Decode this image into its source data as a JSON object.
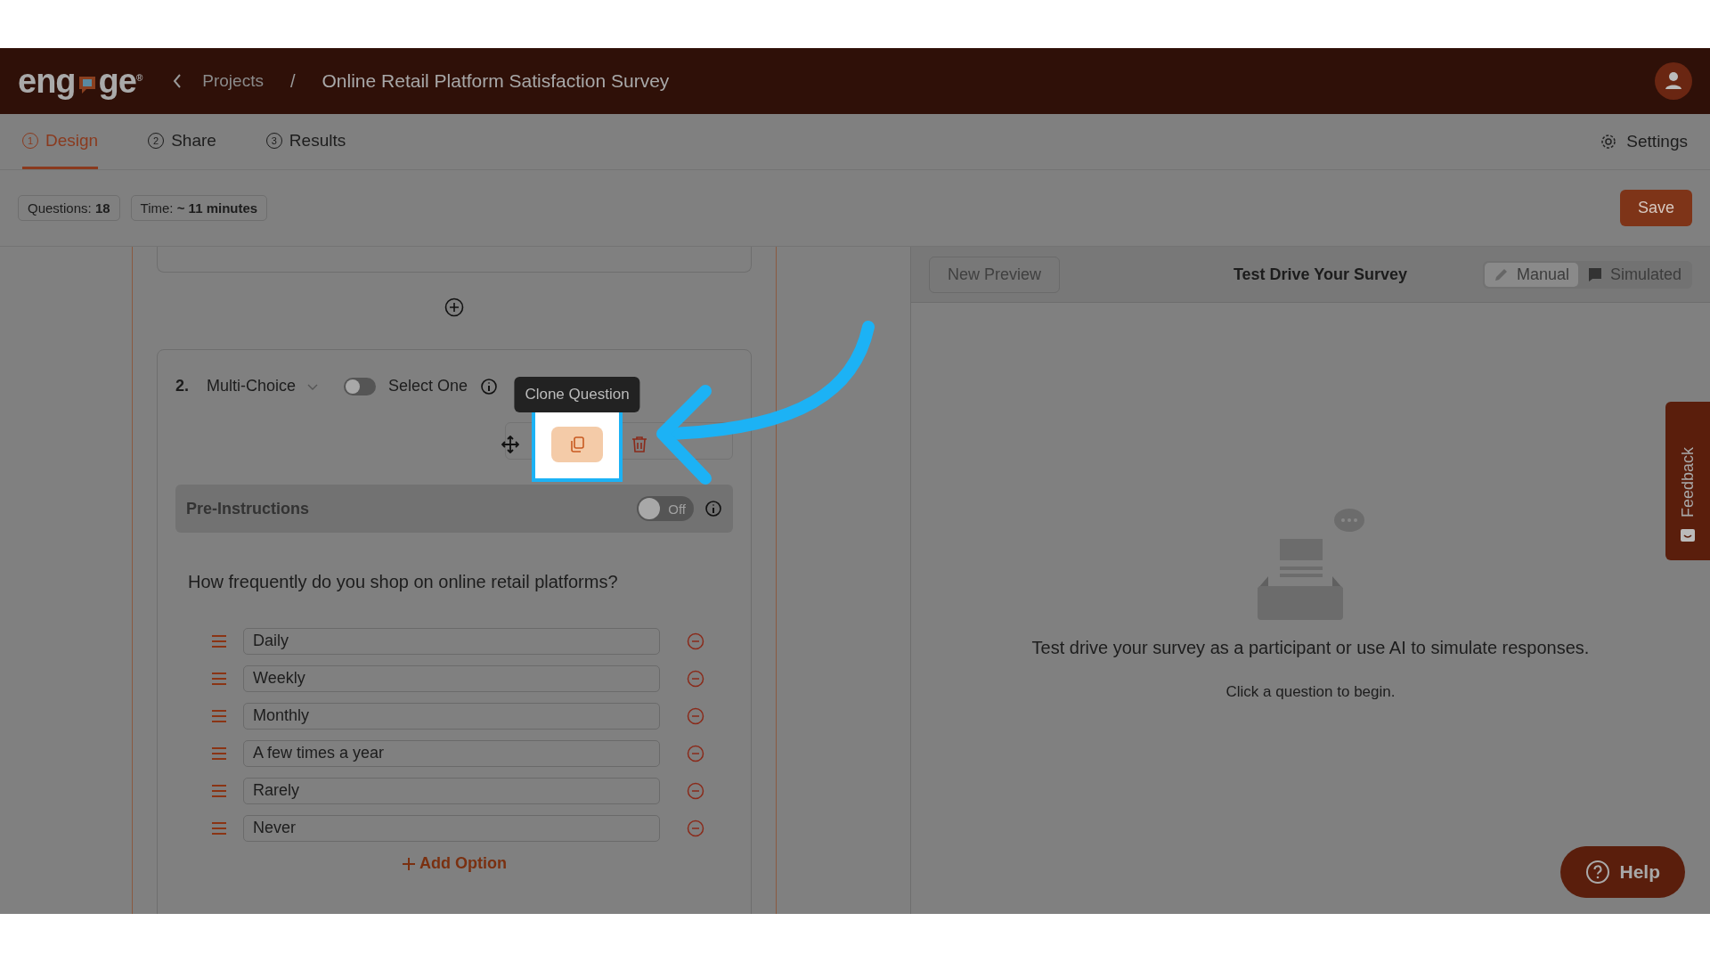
{
  "header": {
    "logo": {
      "before": "eng",
      "after": "ge",
      "mark": "®"
    },
    "breadcrumb": "Projects",
    "separator": "/",
    "title": "Online Retail Platform Satisfaction Survey"
  },
  "tabs": [
    {
      "number": "1",
      "label": "Design",
      "selected": true
    },
    {
      "number": "2",
      "label": "Share",
      "selected": false
    },
    {
      "number": "3",
      "label": "Results",
      "selected": false
    }
  ],
  "settings": "Settings",
  "stats": [
    {
      "label": "Questions:",
      "value": "18"
    },
    {
      "label": "Time:",
      "value": "~ 11 minutes"
    }
  ],
  "save": "Save",
  "question": {
    "number": "2.",
    "type": "Multi-Choice",
    "select_one": {
      "label": "Select One",
      "on": false
    },
    "tooltip": "Clone Question",
    "pre_instructions": {
      "label": "Pre-Instructions",
      "on": false,
      "state_text": "Off"
    },
    "text": "How frequently do you shop on online retail platforms?",
    "options": [
      "Daily",
      "Weekly",
      "Monthly",
      "A few times a year",
      "Rarely",
      "Never"
    ],
    "add_option": "Add Option"
  },
  "preview": {
    "new_preview": "New Preview",
    "title": "Test Drive Your Survey",
    "modes": [
      {
        "label": "Manual",
        "selected": true
      },
      {
        "label": "Simulated",
        "selected": false
      }
    ],
    "message": "Test drive your survey as a participant or use AI to simulate responses.",
    "hint": "Click a question to begin."
  },
  "feedback": "Feedback",
  "help": "Help"
}
